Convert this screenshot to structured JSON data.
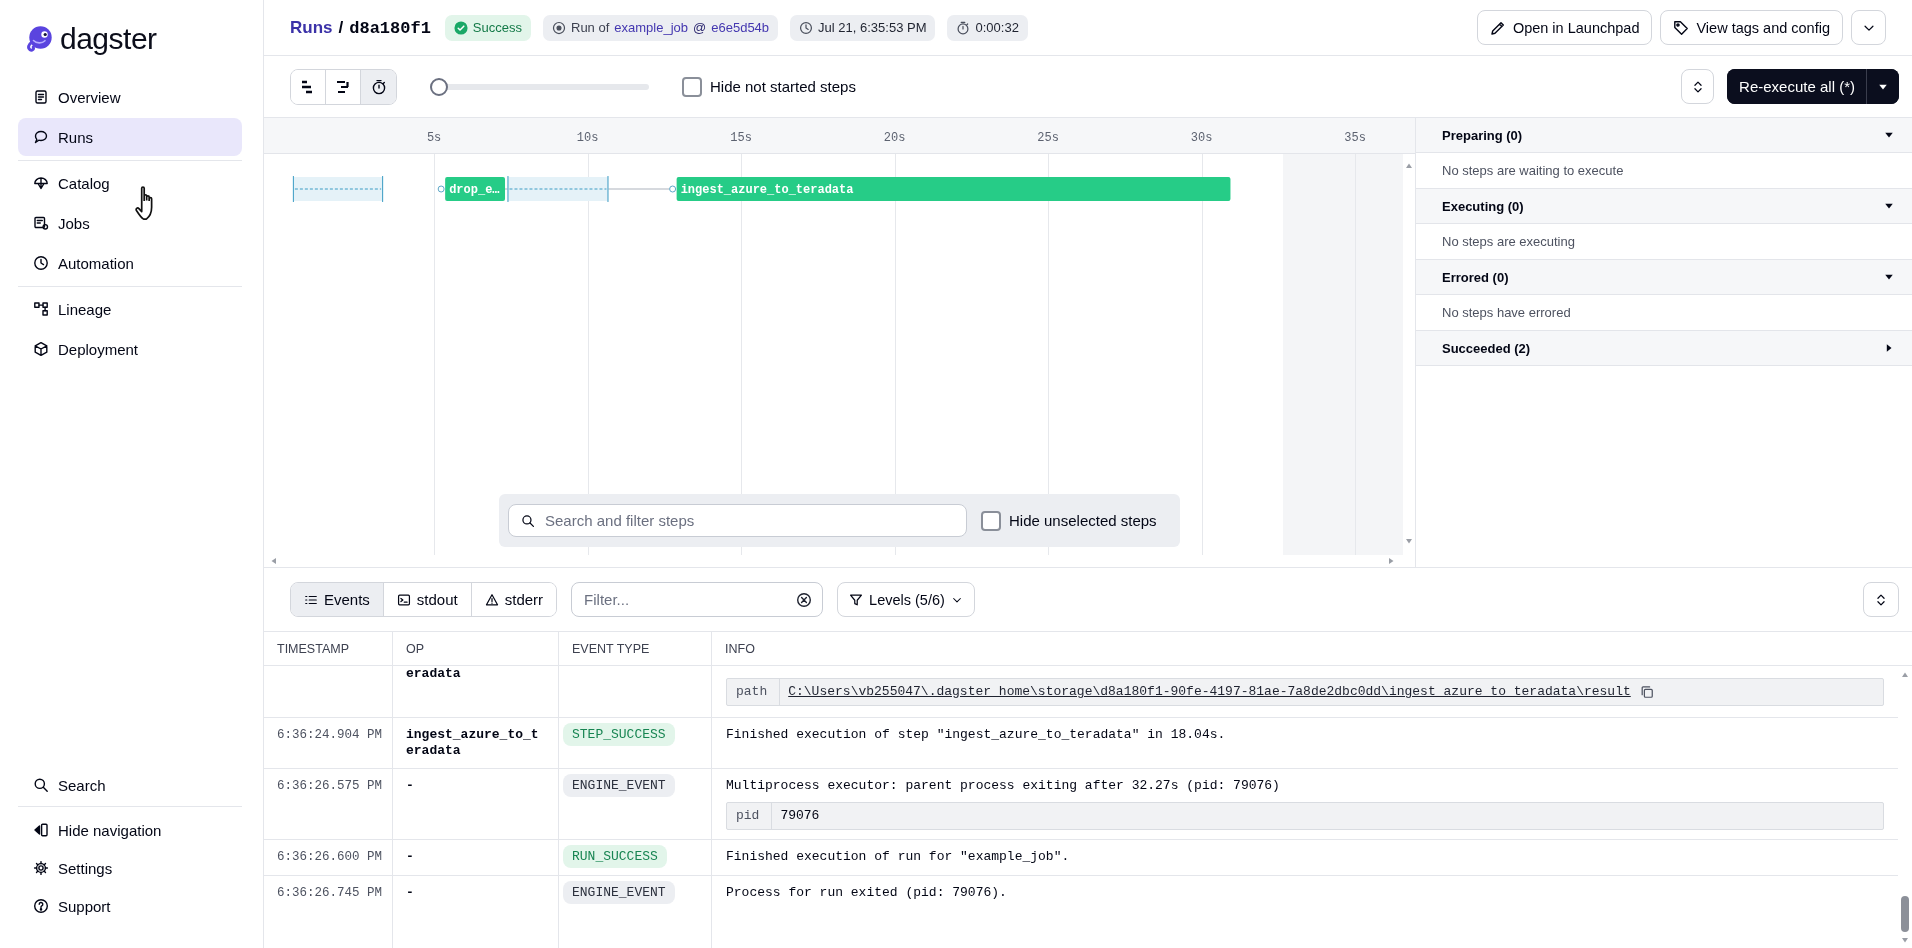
{
  "sidebar": {
    "logo": "dagster",
    "groups": [
      {
        "items": [
          {
            "label": "Overview",
            "selected": false
          },
          {
            "label": "Runs",
            "selected": true
          }
        ]
      },
      {
        "items": [
          {
            "label": "Catalog",
            "selected": false
          },
          {
            "label": "Jobs",
            "selected": false
          },
          {
            "label": "Automation",
            "selected": false
          }
        ]
      },
      {
        "items": [
          {
            "label": "Lineage",
            "selected": false
          },
          {
            "label": "Deployment",
            "selected": false
          }
        ]
      }
    ],
    "footer_groups": [
      [
        "Search"
      ],
      [
        "Hide navigation",
        "Settings",
        "Support"
      ]
    ]
  },
  "header": {
    "breadcrumb": {
      "parent": "Runs",
      "separator": "/",
      "current": "d8a180f1"
    },
    "status": {
      "label": "Success",
      "kind": "success"
    },
    "job_tag": {
      "prefix": "Run of",
      "job": "example_job",
      "separator": "@",
      "snapshot": "e6e5d54b"
    },
    "start_time": "Jul 21, 6:35:53 PM",
    "duration": "0:00:32",
    "actions": [
      "Open in Launchpad",
      "View tags and config"
    ]
  },
  "toolbar": {
    "view_modes": [
      {
        "selected": false
      },
      {
        "selected": false
      },
      {
        "selected": true
      }
    ],
    "zoom": {
      "level": 0
    },
    "hide_not_started": {
      "label": "Hide not started steps",
      "checked": false
    },
    "reexecute": "Re-execute all (*)"
  },
  "gantt": {
    "ticks": [
      "5s",
      "10s",
      "15s",
      "20s",
      "25s",
      "30s",
      "35s"
    ],
    "steps": [
      {
        "label": "drop_e…",
        "kind": "success"
      },
      {
        "label": "ingest_azure_to_teradata",
        "kind": "success"
      }
    ],
    "search": {
      "placeholder": "Search and filter steps"
    },
    "hide_unselected": {
      "label": "Hide unselected steps",
      "checked": false
    }
  },
  "step_panel": {
    "sections": [
      {
        "title": "Preparing (0)",
        "expanded": true,
        "empty_text": "No steps are waiting to execute"
      },
      {
        "title": "Executing (0)",
        "expanded": true,
        "empty_text": "No steps are executing"
      },
      {
        "title": "Errored (0)",
        "expanded": true,
        "empty_text": "No steps have errored"
      },
      {
        "title": "Succeeded (2)",
        "expanded": false
      }
    ]
  },
  "logs": {
    "tabs": [
      {
        "label": "Events",
        "selected": true
      },
      {
        "label": "stdout",
        "selected": false
      },
      {
        "label": "stderr",
        "selected": false
      }
    ],
    "filter": {
      "placeholder": "Filter..."
    },
    "levels": "Levels (5/6)",
    "table": {
      "columns": [
        "TIMESTAMP",
        "OP",
        "EVENT TYPE",
        "INFO"
      ],
      "rows": [
        {
          "op": "eradata",
          "metadata": [
            {
              "key": "path",
              "value": "C:\\Users\\vb255047\\.dagster_home\\storage\\d8a180f1-90fe-4197-81ae-7a8de2dbc0dd\\ingest_azure_to_teradata\\result",
              "kind": "link"
            }
          ]
        },
        {
          "timestamp": "6:36:24.904 PM",
          "op": "ingest_azure_to_teradata",
          "event_type": "STEP_SUCCESS",
          "kind": "success",
          "message": "Finished execution of step \"ingest_azure_to_teradata\" in 18.04s."
        },
        {
          "timestamp": "6:36:26.575 PM",
          "op": "-",
          "event_type": "ENGINE_EVENT",
          "kind": "neutral",
          "message": "Multiprocess executor: parent process exiting after 32.27s (pid: 79076)",
          "metadata": [
            {
              "key": "pid",
              "value": "79076",
              "kind": "text"
            }
          ]
        },
        {
          "timestamp": "6:36:26.600 PM",
          "op": "-",
          "event_type": "RUN_SUCCESS",
          "kind": "success",
          "message": "Finished execution of run for \"example_job\"."
        },
        {
          "timestamp": "6:36:26.745 PM",
          "op": "-",
          "event_type": "ENGINE_EVENT",
          "kind": "neutral",
          "message": "Process for run exited (pid: 79076)."
        }
      ]
    }
  }
}
